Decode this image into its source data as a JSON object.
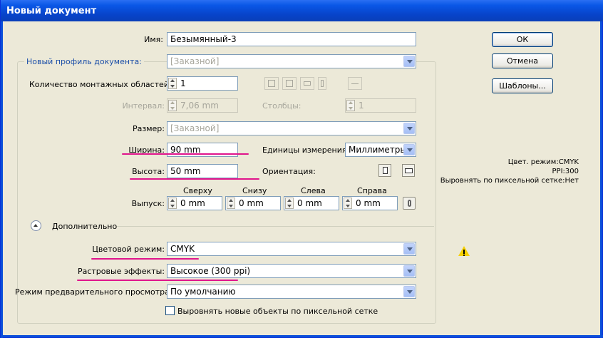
{
  "window": {
    "title": "Новый документ"
  },
  "buttons": {
    "ok": "ОК",
    "cancel": "Отмена",
    "templates": "Шаблоны..."
  },
  "name": {
    "label": "Имя:",
    "value": "Безымянный-3"
  },
  "profile": {
    "label": "Новый профиль документа:",
    "value": "[Заказной]"
  },
  "artboards": {
    "count_label": "Количество монтажных областей:",
    "count_value": "1",
    "interval_label": "Интервал:",
    "interval_value": "7,06 mm",
    "columns_label": "Столбцы:",
    "columns_value": "1"
  },
  "size": {
    "label": "Размер:",
    "value": "[Заказной]"
  },
  "width": {
    "label": "Ширина:",
    "value": "90 mm"
  },
  "height": {
    "label": "Высота:",
    "value": "50 mm"
  },
  "units": {
    "label": "Единицы измерения:",
    "value": "Миллиметры"
  },
  "orientation": {
    "label": "Ориентация:"
  },
  "bleed": {
    "label": "Выпуск:",
    "top_label": "Сверху",
    "top_value": "0 mm",
    "bottom_label": "Снизу",
    "bottom_value": "0 mm",
    "left_label": "Слева",
    "left_value": "0 mm",
    "right_label": "Справа",
    "right_value": "0 mm"
  },
  "advanced": {
    "label": "Дополнительно"
  },
  "color_mode": {
    "label": "Цветовой режим:",
    "value": "CMYK"
  },
  "raster": {
    "label": "Растровые эффекты:",
    "value": "Высокое (300 ppi)"
  },
  "preview": {
    "label": "Режим предварительного просмотра:",
    "value": "По умолчанию"
  },
  "align_checkbox": {
    "label": "Выровнять новые объекты по пиксельной сетке",
    "checked": false
  },
  "info": {
    "color_mode": "Цвет. режим:CMYK",
    "ppi": "PPI:300",
    "align": "Выровнять по пиксельной сетке:Нет"
  },
  "icons": [
    "grid-by-row-icon",
    "grid-by-column-icon",
    "arrange-by-row-icon",
    "arrange-by-column-icon",
    "layout-direction-icon",
    "portrait-icon",
    "landscape-icon",
    "link-bleed-icon",
    "warning-icon",
    "collapse-chevron-icon",
    "dropdown-arrow-icon"
  ],
  "colors": {
    "titlebar": "#0a57e6",
    "highlight_marker": "#e0158c",
    "dialog_bg": "#ece9d8"
  }
}
